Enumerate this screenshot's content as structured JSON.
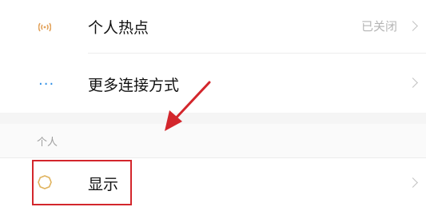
{
  "rows": {
    "hotspot": {
      "label": "个人热点",
      "status": "已关闭",
      "icon": "hotspot-icon"
    },
    "more_connections": {
      "label": "更多连接方式",
      "icon": "more-dots-icon",
      "icon_glyph": "···"
    },
    "display": {
      "label": "显示",
      "icon": "sun-icon"
    }
  },
  "section": {
    "personal_header": "个人"
  },
  "annotation": {
    "highlight_color": "#d3262c",
    "arrow_color": "#d3262c"
  },
  "colors": {
    "accent_blue": "#2f8fe6",
    "hotspot_icon": "#e2a25a",
    "display_icon": "#e0b35e"
  }
}
